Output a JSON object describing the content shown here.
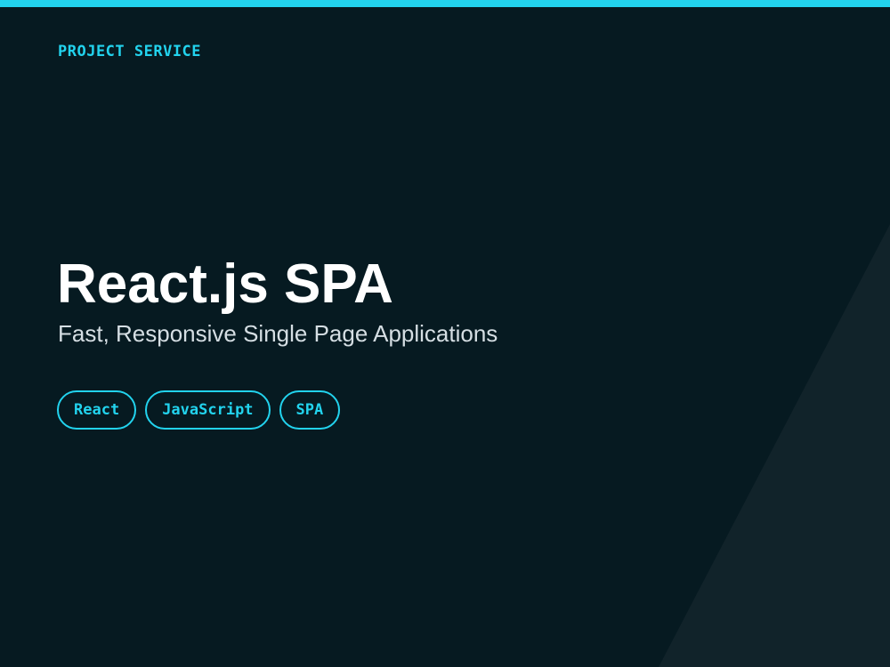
{
  "header": {
    "eyebrow": "PROJECT SERVICE"
  },
  "hero": {
    "title": "React.js SPA",
    "subtitle": "Fast, Responsive Single Page Applications"
  },
  "tags": [
    "React",
    "JavaScript",
    "SPA"
  ],
  "colors": {
    "background": "#061a21",
    "accent": "#22d3ee",
    "title": "#ffffff",
    "subtitle": "#d5dee3",
    "decor_shape": "#11232a"
  }
}
